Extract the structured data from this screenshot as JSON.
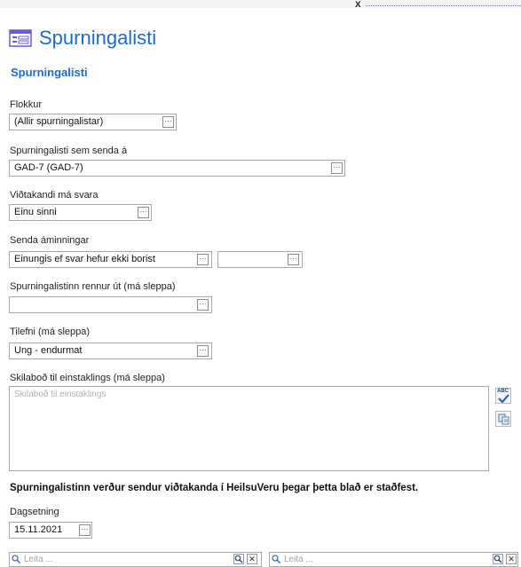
{
  "window": {
    "close_glyph": "x"
  },
  "header": {
    "title": "Spurningalisti",
    "icon": "form-list-icon"
  },
  "section": {
    "title": "Spurningalisti"
  },
  "fields": {
    "category": {
      "label": "Flokkur",
      "value": "(Allir spurningalistar)"
    },
    "questionnaire": {
      "label": "Spurningalisti sem senda á",
      "value": "GAD-7 (GAD-7)"
    },
    "recipient_may_answer": {
      "label": "Viðtakandi má svara",
      "value": "Einu sinni"
    },
    "send_reminders": {
      "label": "Senda áminningar",
      "value": "Einungis ef svar hefur ekki borist",
      "value2": ""
    },
    "expires": {
      "label": "Spurningalistinn rennur út (má sleppa)",
      "value": ""
    },
    "occasion": {
      "label": "Tilefni (má sleppa)",
      "value": "Ung - endurmat"
    },
    "message": {
      "label": "Skilaboð til einstaklings (má sleppa)",
      "placeholder": "Skilaboð til einstaklings"
    },
    "date": {
      "label": "Dagsetning",
      "value": "15.11.2021"
    }
  },
  "buttons": {
    "ellipsis": "···",
    "spellcheck_text": "ABC",
    "spellcheck_icon": "spellcheck-icon",
    "copy_icon": "copy-icon"
  },
  "notice": "Spurningalistinn verður sendur viðtakanda í HeilsuVeru þegar þetta blað er staðfest.",
  "search": {
    "placeholder_left": "Leita ...",
    "placeholder_right": "Leita ...",
    "clear_glyph": "✕"
  },
  "colors": {
    "accent": "#1f6bc7",
    "border": "#a9a9a9"
  }
}
